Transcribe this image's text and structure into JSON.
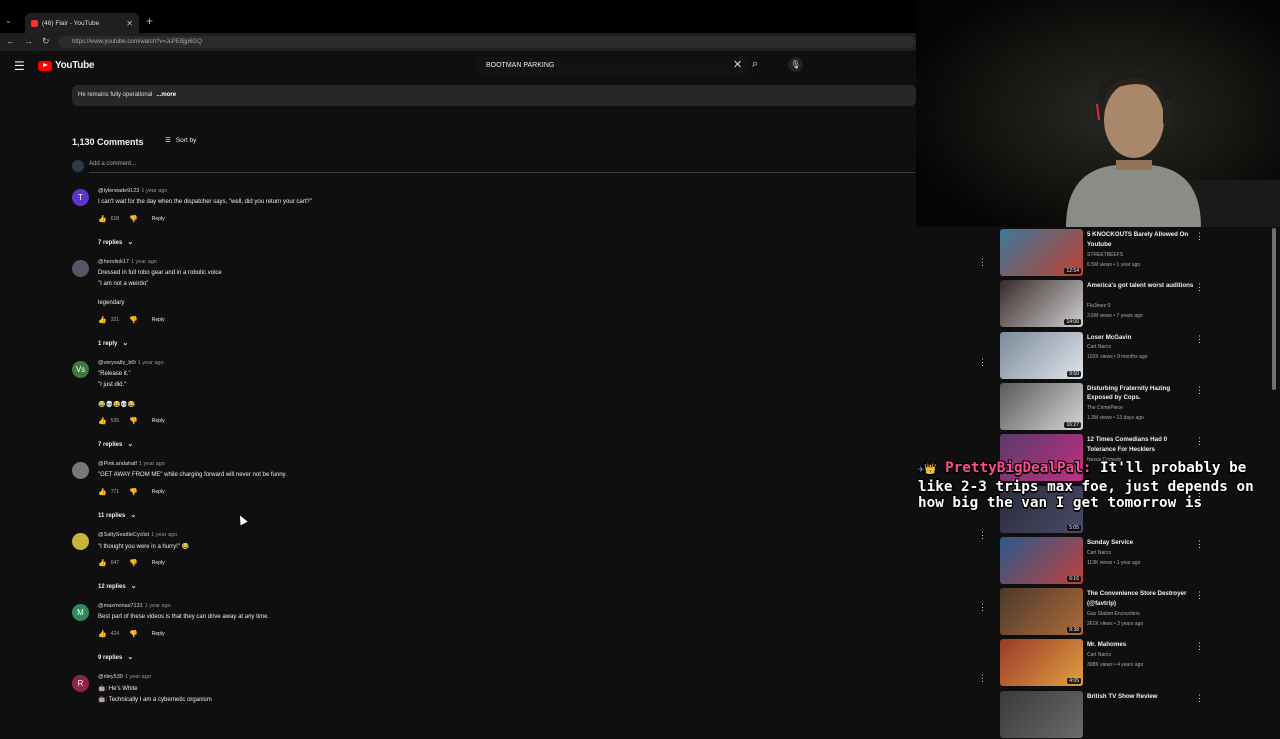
{
  "browser": {
    "tab_title": "(46) Flair - YouTube",
    "url": "https://www.youtube.com/watch?v=JcPE8jjp6GQ"
  },
  "header": {
    "logo": "YouTube",
    "search_value": "BOOTMAN PARKING"
  },
  "description": {
    "text": "He remains fully operational",
    "more": "...more"
  },
  "comments_header": {
    "count": "1,130 Comments",
    "sort": "Sort by",
    "add_placeholder": "Add a comment..."
  },
  "comments": [
    {
      "avatar": "T",
      "avatar_color": "#5c35cc",
      "user": "@tylerwade9123",
      "ago": "1 year ago",
      "lines": [
        "I can't wait for the day when the dispatcher says, \"well, did you return your cart?\""
      ],
      "likes": "618",
      "reply": "Reply",
      "replies": "7 replies"
    },
    {
      "avatar": "",
      "avatar_color": "#556",
      "user": "@herolink17",
      "ago": "1 year ago",
      "lines": [
        "Dressed in full robo gear and in a robotic voice",
        "\"I am not a weirdo\"",
        "",
        "legendary"
      ],
      "likes": "321",
      "reply": "Reply",
      "replies": "1 reply"
    },
    {
      "avatar": "Vs",
      "avatar_color": "#3c7a3c",
      "user": "@verysalty_b0i",
      "ago": "1 year ago",
      "lines": [
        "\"Release it.\"",
        "\"I just did.\"",
        "",
        "😂💀😂💀😂"
      ],
      "likes": "526",
      "reply": "Reply",
      "replies": "7 replies"
    },
    {
      "avatar": "",
      "avatar_color": "#777",
      "user": "@Pink.andahalf",
      "ago": "1 year ago",
      "lines": [
        "\"GET AWAY FROM ME\" while charging forward will never not be funny."
      ],
      "likes": "771",
      "reply": "Reply",
      "replies": "11 replies"
    },
    {
      "avatar": "",
      "avatar_color": "#c9b43a",
      "user": "@SaltySeattleCyclist",
      "ago": "1 year ago",
      "lines": [
        "\"I thought you were in a hurry!\" 😂"
      ],
      "likes": "647",
      "reply": "Reply",
      "replies": "12 replies"
    },
    {
      "avatar": "M",
      "avatar_color": "#2e8b57",
      "user": "@maxmonas7131",
      "ago": "1 year ago",
      "lines": [
        "Best part of these videos is that they can drive away at any time."
      ],
      "likes": "424",
      "reply": "Reply",
      "replies": "9 replies"
    },
    {
      "avatar": "R",
      "avatar_color": "#8e244d",
      "user": "@riley539",
      "ago": "1 year ago",
      "lines": [
        "🤖: He's White",
        "🤖: Technically I am a cybernetic organism"
      ],
      "likes": "",
      "reply": "",
      "replies": ""
    }
  ],
  "sidebar": [
    {
      "title": "5 KNOCKOUTS Barely Allowed On Youtube",
      "channel": "STREETBEEFS",
      "views": "6.5M views • 1 year ago",
      "duration": "12:54",
      "c1": "#3a7a9a",
      "c2": "#c04030"
    },
    {
      "title": "America's got talent worst auditions",
      "channel": "Fla3mez 0",
      "views": "3.6M views • 7 years ago",
      "duration": "14:06",
      "c1": "#3a2a2a",
      "c2": "#cfcfcf"
    },
    {
      "title": "Loser McGavin",
      "channel": "Cart Narcs",
      "views": "102K views • 9 months ago",
      "duration": "9:50",
      "c1": "#7a8a9a",
      "c2": "#dfe4ea"
    },
    {
      "title": "Disturbing Fraternity Hazing Exposed by Cops.",
      "channel": "The CrimePiece",
      "views": "1.3M views • 13 days ago",
      "duration": "16:27",
      "c1": "#5a5a5a",
      "c2": "#d6d6d6"
    },
    {
      "title": "12 Times Comedians Had 0 Tolerance For Hecklers",
      "channel": "Nexus Comedy",
      "views": "",
      "duration": "",
      "c1": "#5a3a6a",
      "c2": "#c03080"
    },
    {
      "title": "",
      "channel": "",
      "views": "",
      "duration": "5:05",
      "c1": "#2a2a3a",
      "c2": "#4a4a6a"
    },
    {
      "title": "Sunday Service",
      "channel": "Cart Narcs",
      "views": "113K views • 1 year ago",
      "duration": "6:16",
      "c1": "#2a5a8a",
      "c2": "#c04040"
    },
    {
      "title": "The Convenience Store Destroyer (@favtrip)",
      "channel": "Gas Station Encounters",
      "views": "261K views • 3 years ago",
      "duration": "8:38",
      "c1": "#4a3a2a",
      "c2": "#b06a3a"
    },
    {
      "title": "Mr. Mahomes",
      "channel": "Cart Narcs",
      "views": "398K views • 4 years ago",
      "duration": "4:05",
      "c1": "#9a3a2a",
      "c2": "#e0a040"
    },
    {
      "title": "British TV Show Review",
      "channel": "",
      "views": "",
      "duration": "",
      "c1": "#3a3a3a",
      "c2": "#6a6a6a"
    }
  ],
  "overlay": {
    "user": "PrettyBigDealPal:",
    "message": " It'll probably be like 2-3 trips max foe, just depends on how big the van I get tomorrow is"
  }
}
